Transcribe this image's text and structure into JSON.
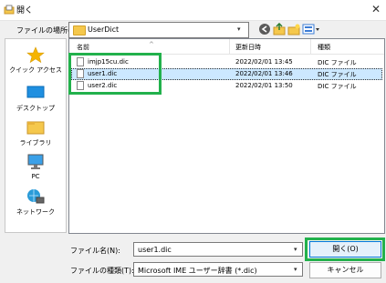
{
  "window": {
    "title": "開く",
    "close_glyph": "✕"
  },
  "lookin": {
    "label": "ファイルの場所(I):",
    "value": "UserDict",
    "arrow": "▾"
  },
  "places": [
    {
      "label": "クイック アクセス",
      "icon": "star-icon"
    },
    {
      "label": "デスクトップ",
      "icon": "desktop-icon"
    },
    {
      "label": "ライブラリ",
      "icon": "library-folder-icon"
    },
    {
      "label": "PC",
      "icon": "pc-monitor-icon"
    },
    {
      "label": "ネットワーク",
      "icon": "network-icon"
    }
  ],
  "filelist": {
    "sort_glyph": "^",
    "columns": {
      "name": "名前",
      "date": "更新日時",
      "type": "種類"
    },
    "rows": [
      {
        "name": "imjp15cu.dic",
        "date": "2022/02/01 13:45",
        "type": "DIC ファイル",
        "selected": false
      },
      {
        "name": "user1.dic",
        "date": "2022/02/01 13:46",
        "type": "DIC ファイル",
        "selected": true
      },
      {
        "name": "user2.dic",
        "date": "2022/02/01 13:50",
        "type": "DIC ファイル",
        "selected": false
      }
    ]
  },
  "filename": {
    "label": "ファイル名(N):",
    "value": "user1.dic",
    "arrow": "▾"
  },
  "filetype": {
    "label": "ファイルの種類(T):",
    "value": "Microsoft IME ユーザー辞書 (*.dic)",
    "arrow": "▾"
  },
  "buttons": {
    "open": "開く(O)",
    "cancel": "キャンセル"
  },
  "colors": {
    "highlight_green": "#22b14c",
    "selection_blue": "#cce8ff",
    "primary_border": "#0078d7"
  }
}
